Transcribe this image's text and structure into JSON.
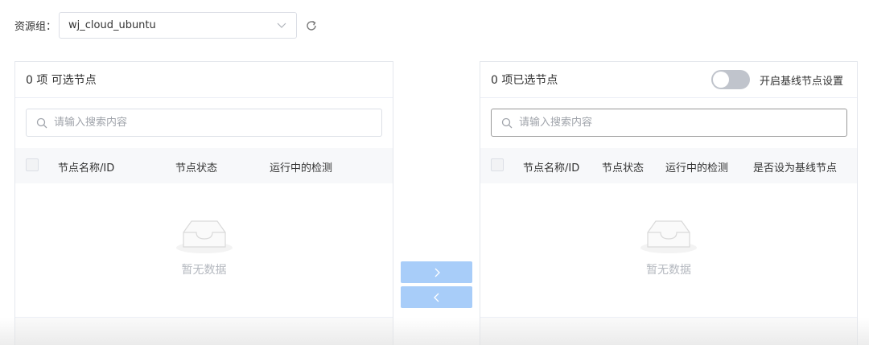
{
  "resource_group": {
    "label": "资源组：",
    "selected": "wj_cloud_ubuntu"
  },
  "left_panel": {
    "title": "0 项 可选节点",
    "search_placeholder": "请输入搜索内容",
    "columns": [
      "节点名称/ID",
      "节点状态",
      "运行中的检测"
    ],
    "empty_text": "暂无数据"
  },
  "right_panel": {
    "title": "0 项已选节点",
    "toggle_label": "开启基线节点设置",
    "search_placeholder": "请输入搜索内容",
    "columns": [
      "节点名称/ID",
      "节点状态",
      "运行中的检测",
      "是否设为基线节点"
    ],
    "empty_text": "暂无数据"
  },
  "icons": {
    "select": "chevron-down-icon",
    "refresh": "refresh-icon",
    "search": "search-icon",
    "empty": "empty-inbox-icon",
    "move_right": "chevron-right-icon",
    "move_left": "chevron-left-icon"
  },
  "colors": {
    "transfer_button": "#a8cdf9",
    "toggle_off": "#c0c4cc",
    "header_bg": "#f7f8fa"
  }
}
